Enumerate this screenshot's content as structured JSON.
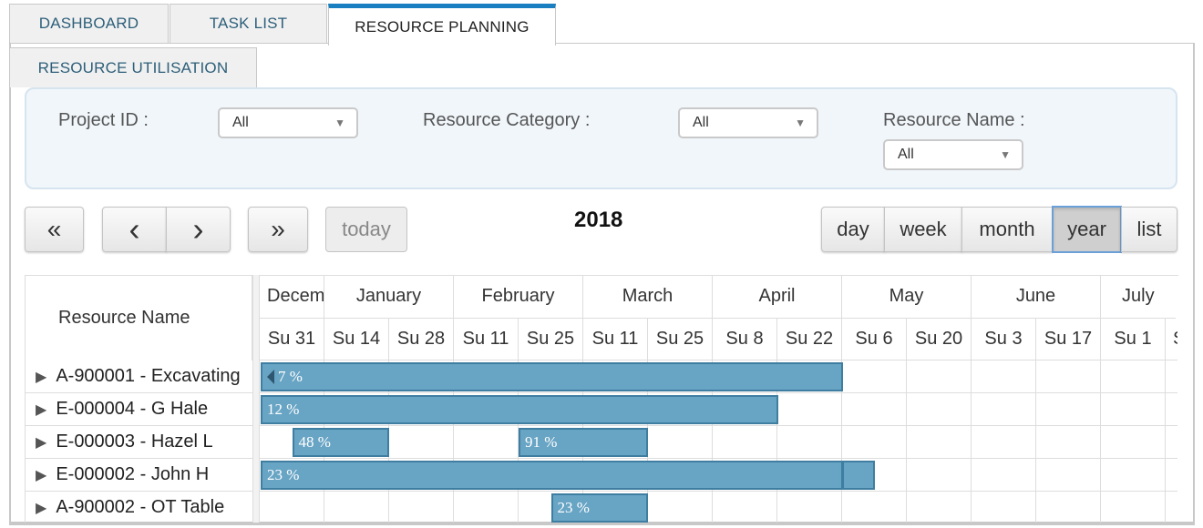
{
  "tabs": [
    {
      "label": "DASHBOARD",
      "active": false
    },
    {
      "label": "TASK LIST",
      "active": false
    },
    {
      "label": "RESOURCE PLANNING",
      "active": true
    },
    {
      "label": "RESOURCE UTILISATION",
      "active": false
    }
  ],
  "filters": {
    "project_id": {
      "label": "Project ID :",
      "value": "All"
    },
    "resource_category": {
      "label": "Resource Category :",
      "value": "All"
    },
    "resource_name": {
      "label": "Resource Name :",
      "value": "All"
    }
  },
  "toolbar": {
    "prev_year": "«",
    "prev": "‹",
    "next": "›",
    "next_year": "»",
    "today": "today",
    "title": "2018",
    "views": [
      {
        "label": "day",
        "active": false
      },
      {
        "label": "week",
        "active": false
      },
      {
        "label": "month",
        "active": false
      },
      {
        "label": "year",
        "active": true
      },
      {
        "label": "list",
        "active": false
      }
    ]
  },
  "timeline": {
    "resource_header": "Resource Name",
    "months": [
      "Decem",
      "January",
      "February",
      "March",
      "April",
      "May",
      "June",
      "July"
    ],
    "weeks": [
      "Su 31",
      "Su 14",
      "Su 28",
      "Su 11",
      "Su 25",
      "Su 11",
      "Su 25",
      "Su 8",
      "Su 22",
      "Su 6",
      "Su 20",
      "Su 3",
      "Su 17",
      "Su 1",
      "S"
    ]
  },
  "resources": [
    {
      "name": "A-900001 - Excavating",
      "bars": [
        {
          "label": "7 %",
          "start_week": 0,
          "end_week": 9.0,
          "continues_left": true
        }
      ]
    },
    {
      "name": "E-000004 - G Hale",
      "bars": [
        {
          "label": "12 %",
          "start_week": 0,
          "end_week": 8.0
        }
      ]
    },
    {
      "name": "E-000003 - Hazel L",
      "bars": [
        {
          "label": "48 %",
          "start_week": 0.5,
          "end_week": 2.0
        },
        {
          "label": "91 %",
          "start_week": 4.0,
          "end_week": 6.0
        }
      ]
    },
    {
      "name": "E-000002 - John H",
      "bars": [
        {
          "label": "23 %",
          "start_week": 0,
          "end_week": 9.0
        },
        {
          "label": "",
          "start_week": 9.0,
          "end_week": 9.5
        }
      ]
    },
    {
      "name": "A-900002 - OT Table",
      "bars": [
        {
          "label": "23 %",
          "start_week": 4.5,
          "end_week": 6.0
        }
      ]
    }
  ],
  "colors": {
    "accent": "#1a7fc0",
    "bar_fill": "#68a4c4",
    "bar_border": "#3f7ea0",
    "filter_bg": "#f1f6fb",
    "tab_text": "#2d5f7a"
  }
}
